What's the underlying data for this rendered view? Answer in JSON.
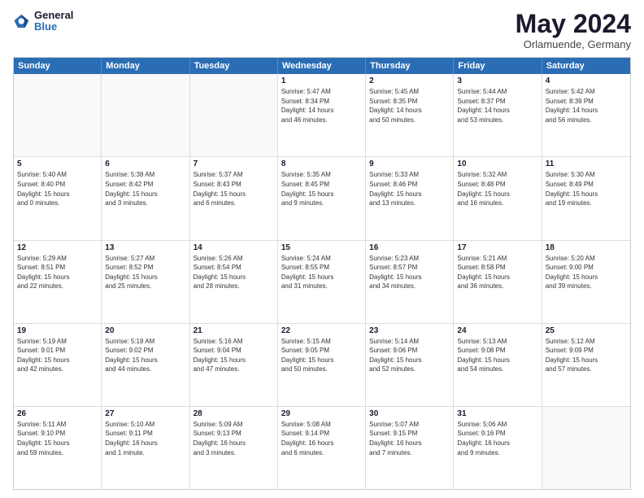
{
  "header": {
    "logo": {
      "line1": "General",
      "line2": "Blue"
    },
    "title": "May 2024",
    "subtitle": "Orlamuende, Germany"
  },
  "calendar": {
    "days_of_week": [
      "Sunday",
      "Monday",
      "Tuesday",
      "Wednesday",
      "Thursday",
      "Friday",
      "Saturday"
    ],
    "weeks": [
      [
        {
          "day": "",
          "info": ""
        },
        {
          "day": "",
          "info": ""
        },
        {
          "day": "",
          "info": ""
        },
        {
          "day": "1",
          "info": "Sunrise: 5:47 AM\nSunset: 8:34 PM\nDaylight: 14 hours\nand 46 minutes."
        },
        {
          "day": "2",
          "info": "Sunrise: 5:45 AM\nSunset: 8:35 PM\nDaylight: 14 hours\nand 50 minutes."
        },
        {
          "day": "3",
          "info": "Sunrise: 5:44 AM\nSunset: 8:37 PM\nDaylight: 14 hours\nand 53 minutes."
        },
        {
          "day": "4",
          "info": "Sunrise: 5:42 AM\nSunset: 8:39 PM\nDaylight: 14 hours\nand 56 minutes."
        }
      ],
      [
        {
          "day": "5",
          "info": "Sunrise: 5:40 AM\nSunset: 8:40 PM\nDaylight: 15 hours\nand 0 minutes."
        },
        {
          "day": "6",
          "info": "Sunrise: 5:38 AM\nSunset: 8:42 PM\nDaylight: 15 hours\nand 3 minutes."
        },
        {
          "day": "7",
          "info": "Sunrise: 5:37 AM\nSunset: 8:43 PM\nDaylight: 15 hours\nand 6 minutes."
        },
        {
          "day": "8",
          "info": "Sunrise: 5:35 AM\nSunset: 8:45 PM\nDaylight: 15 hours\nand 9 minutes."
        },
        {
          "day": "9",
          "info": "Sunrise: 5:33 AM\nSunset: 8:46 PM\nDaylight: 15 hours\nand 13 minutes."
        },
        {
          "day": "10",
          "info": "Sunrise: 5:32 AM\nSunset: 8:48 PM\nDaylight: 15 hours\nand 16 minutes."
        },
        {
          "day": "11",
          "info": "Sunrise: 5:30 AM\nSunset: 8:49 PM\nDaylight: 15 hours\nand 19 minutes."
        }
      ],
      [
        {
          "day": "12",
          "info": "Sunrise: 5:29 AM\nSunset: 8:51 PM\nDaylight: 15 hours\nand 22 minutes."
        },
        {
          "day": "13",
          "info": "Sunrise: 5:27 AM\nSunset: 8:52 PM\nDaylight: 15 hours\nand 25 minutes."
        },
        {
          "day": "14",
          "info": "Sunrise: 5:26 AM\nSunset: 8:54 PM\nDaylight: 15 hours\nand 28 minutes."
        },
        {
          "day": "15",
          "info": "Sunrise: 5:24 AM\nSunset: 8:55 PM\nDaylight: 15 hours\nand 31 minutes."
        },
        {
          "day": "16",
          "info": "Sunrise: 5:23 AM\nSunset: 8:57 PM\nDaylight: 15 hours\nand 34 minutes."
        },
        {
          "day": "17",
          "info": "Sunrise: 5:21 AM\nSunset: 8:58 PM\nDaylight: 15 hours\nand 36 minutes."
        },
        {
          "day": "18",
          "info": "Sunrise: 5:20 AM\nSunset: 9:00 PM\nDaylight: 15 hours\nand 39 minutes."
        }
      ],
      [
        {
          "day": "19",
          "info": "Sunrise: 5:19 AM\nSunset: 9:01 PM\nDaylight: 15 hours\nand 42 minutes."
        },
        {
          "day": "20",
          "info": "Sunrise: 5:18 AM\nSunset: 9:02 PM\nDaylight: 15 hours\nand 44 minutes."
        },
        {
          "day": "21",
          "info": "Sunrise: 5:16 AM\nSunset: 9:04 PM\nDaylight: 15 hours\nand 47 minutes."
        },
        {
          "day": "22",
          "info": "Sunrise: 5:15 AM\nSunset: 9:05 PM\nDaylight: 15 hours\nand 50 minutes."
        },
        {
          "day": "23",
          "info": "Sunrise: 5:14 AM\nSunset: 9:06 PM\nDaylight: 15 hours\nand 52 minutes."
        },
        {
          "day": "24",
          "info": "Sunrise: 5:13 AM\nSunset: 9:08 PM\nDaylight: 15 hours\nand 54 minutes."
        },
        {
          "day": "25",
          "info": "Sunrise: 5:12 AM\nSunset: 9:09 PM\nDaylight: 15 hours\nand 57 minutes."
        }
      ],
      [
        {
          "day": "26",
          "info": "Sunrise: 5:11 AM\nSunset: 9:10 PM\nDaylight: 15 hours\nand 59 minutes."
        },
        {
          "day": "27",
          "info": "Sunrise: 5:10 AM\nSunset: 9:11 PM\nDaylight: 16 hours\nand 1 minute."
        },
        {
          "day": "28",
          "info": "Sunrise: 5:09 AM\nSunset: 9:13 PM\nDaylight: 16 hours\nand 3 minutes."
        },
        {
          "day": "29",
          "info": "Sunrise: 5:08 AM\nSunset: 9:14 PM\nDaylight: 16 hours\nand 6 minutes."
        },
        {
          "day": "30",
          "info": "Sunrise: 5:07 AM\nSunset: 9:15 PM\nDaylight: 16 hours\nand 7 minutes."
        },
        {
          "day": "31",
          "info": "Sunrise: 5:06 AM\nSunset: 9:16 PM\nDaylight: 16 hours\nand 9 minutes."
        },
        {
          "day": "",
          "info": ""
        }
      ]
    ]
  }
}
